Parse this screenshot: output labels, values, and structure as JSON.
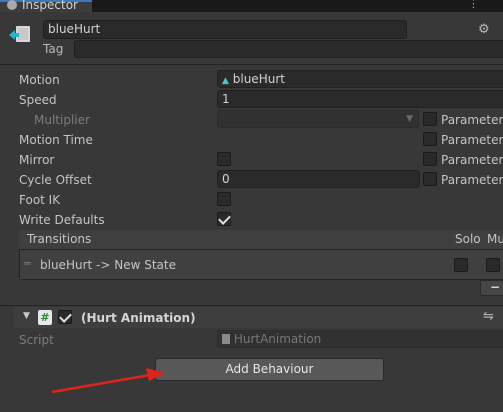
{
  "window": {
    "tab_title": "Inspector"
  },
  "header": {
    "name": "blueHurt",
    "tag_label": "Tag"
  },
  "state": {
    "motion": {
      "label": "Motion",
      "value": "blueHurt"
    },
    "speed": {
      "label": "Speed",
      "value": "1"
    },
    "multiplier": {
      "label": "Multiplier",
      "param": "Parameter"
    },
    "motion_time": {
      "label": "Motion Time",
      "param": "Parameter"
    },
    "mirror": {
      "label": "Mirror",
      "param": "Parameter"
    },
    "cycle_offset": {
      "label": "Cycle Offset",
      "value": "0",
      "param": "Parameter"
    },
    "foot_ik": {
      "label": "Foot IK"
    },
    "write_defaults": {
      "label": "Write Defaults",
      "checked": true
    }
  },
  "transitions": {
    "header": "Transitions",
    "col_solo": "Solo",
    "col_mute": "Mu",
    "rows": [
      {
        "label": "blueHurt -> New State"
      }
    ],
    "remove_label": "−"
  },
  "component": {
    "title": "(Hurt Animation)",
    "script_label": "Script",
    "script_value": "HurtAnimation"
  },
  "add_behaviour": "Add Behaviour"
}
